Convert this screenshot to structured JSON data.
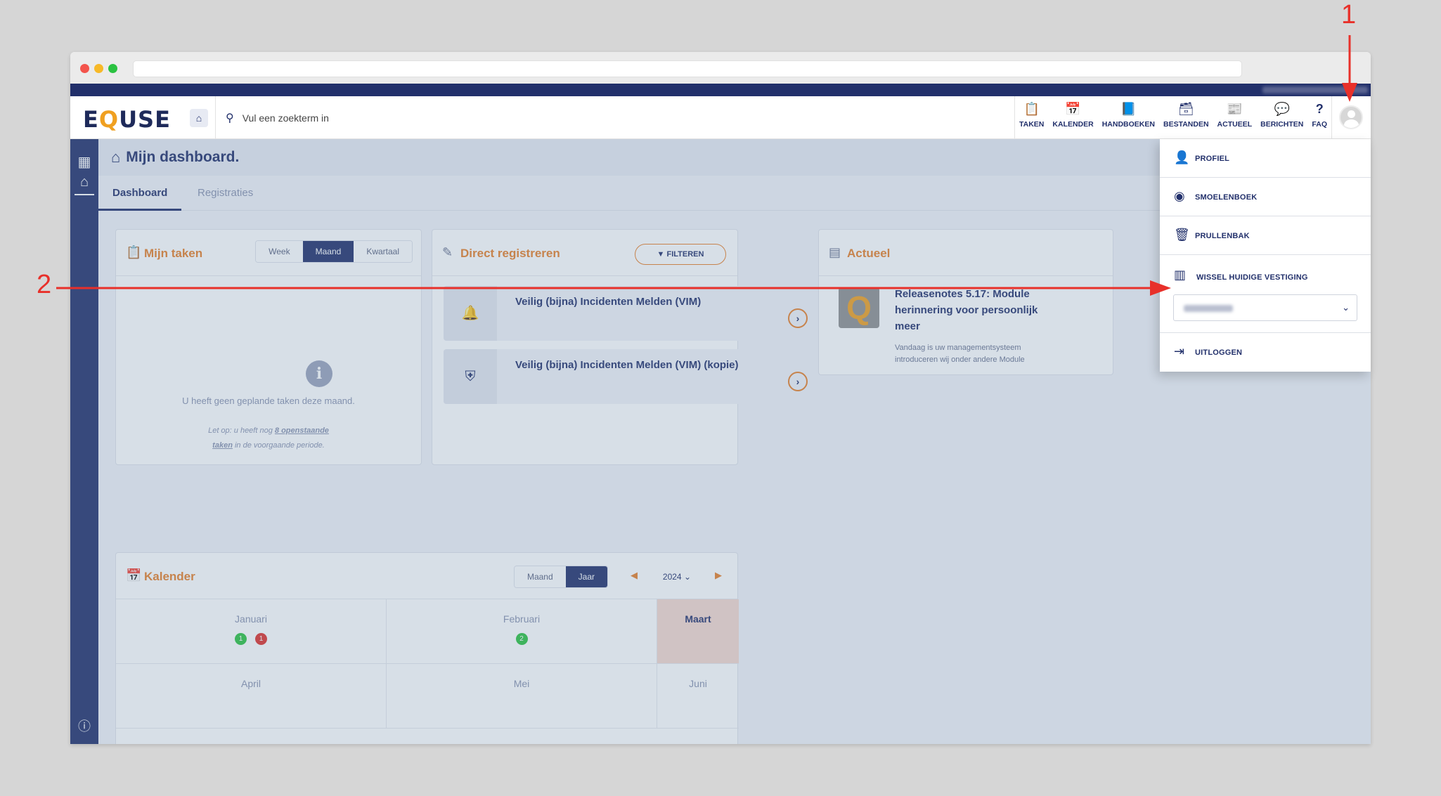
{
  "header": {
    "logo_left": "E",
    "logo_q": "Q",
    "logo_right": "USE",
    "search_placeholder": "Vul een zoekterm in",
    "nav": [
      {
        "label": "TAKEN",
        "icon": "clipboard-icon",
        "glyph": "📋"
      },
      {
        "label": "KALENDER",
        "icon": "calendar-icon",
        "glyph": "📅"
      },
      {
        "label": "HANDBOEKEN",
        "icon": "book-icon",
        "glyph": "📘"
      },
      {
        "label": "BESTANDEN",
        "icon": "archive-icon",
        "glyph": "🗃"
      },
      {
        "label": "ACTUEEL",
        "icon": "newspaper-icon",
        "glyph": "📰"
      },
      {
        "label": "BERICHTEN",
        "icon": "chat-icon",
        "glyph": "💬"
      },
      {
        "label": "FAQ",
        "icon": "question-icon",
        "glyph": "?"
      }
    ]
  },
  "page": {
    "title": "Mijn dashboard.",
    "tabs": [
      "Dashboard",
      "Registraties"
    ]
  },
  "tasks": {
    "title": "Mijn taken",
    "periods": [
      "Week",
      "Maand",
      "Kwartaal"
    ],
    "selected_period": "Maand",
    "empty_text": "U heeft geen geplande taken deze maand.",
    "note_before": "Let op: u heeft nog ",
    "note_link": "8 openstaande taken",
    "note_after": " in de voorgaande periode."
  },
  "register": {
    "title": "Direct registreren",
    "filter_label": "FILTEREN",
    "items": [
      {
        "label": "Veilig (bijna) Incidenten Melden (VIM)",
        "icon": "bell-icon"
      },
      {
        "label": "Veilig (bijna) Incidenten Melden (VIM) (kopie)",
        "icon": "shield-icon"
      }
    ]
  },
  "news": {
    "title": "Actueel",
    "item_title_lines": [
      "Releasenotes 5.17: Module",
      "herinnering voor persoonlijk",
      "meer"
    ],
    "item_sub_lines": [
      "Vandaag is uw managementsysteem",
      "introduceren wij onder andere Module"
    ]
  },
  "calendar": {
    "title": "Kalender",
    "views": [
      "Maand",
      "Jaar"
    ],
    "selected_view": "Jaar",
    "year": "2024",
    "months": [
      {
        "name": "Januari",
        "badges": [
          {
            "value": "1",
            "color": "green"
          },
          {
            "value": "1",
            "color": "red"
          }
        ]
      },
      {
        "name": "Februari",
        "badges": [
          {
            "value": "2",
            "color": "green"
          }
        ]
      },
      {
        "name": "Maart",
        "badges": [],
        "current": true
      },
      {
        "name": "April",
        "badges": []
      },
      {
        "name": "Mei",
        "badges": []
      },
      {
        "name": "Juni",
        "badges": []
      }
    ]
  },
  "user_menu": {
    "items": [
      "PROFIEL",
      "SMOELENBOEK",
      "PRULLENBAK",
      "WISSEL HUIDIGE VESTIGING",
      "UITLOGGEN"
    ],
    "vestiging_selected": "DEMO omgeving"
  },
  "annotations": [
    "1",
    "2"
  ],
  "colors": {
    "navy": "#22306b",
    "accent_orange": "#e8802a",
    "annotation_red": "#e8302a"
  }
}
